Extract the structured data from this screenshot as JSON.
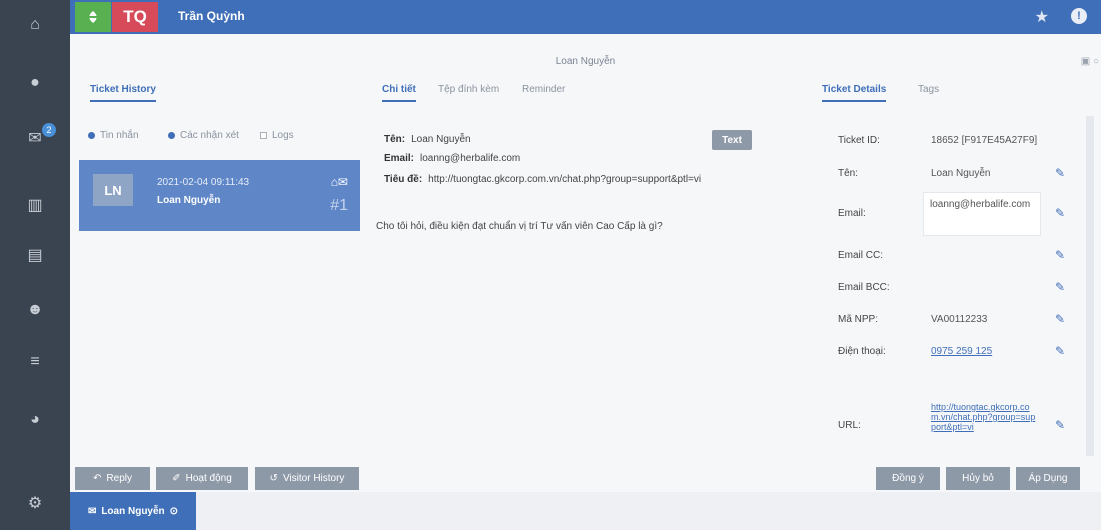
{
  "header": {
    "logo_icon": "herbalife-leaf-icon",
    "avatar_initials": "TQ",
    "user_name": "Trần Quỳnh",
    "star_glyph": "★",
    "info_glyph": "!"
  },
  "rail": {
    "items": [
      {
        "name": "home-icon",
        "glyph": "⌂"
      },
      {
        "name": "chat-icon",
        "glyph": "●"
      },
      {
        "name": "mail-icon",
        "glyph": "✉",
        "badge": "2"
      },
      {
        "name": "map-icon",
        "glyph": "▥"
      },
      {
        "name": "archive-icon",
        "glyph": "▤"
      },
      {
        "name": "users-icon",
        "glyph": "☻"
      },
      {
        "name": "database-icon",
        "glyph": "≡"
      },
      {
        "name": "pie-chart-icon",
        "glyph": "◕"
      },
      {
        "name": "settings-icon",
        "glyph": "⚙"
      }
    ]
  },
  "contact_title": "Loan Nguyễn",
  "window_controls": "▣ ○",
  "left_panel": {
    "tab_label": "Ticket History",
    "filters": [
      {
        "label": "Tin nhắn",
        "checked": true
      },
      {
        "label": "Các nhận xét",
        "checked": true
      },
      {
        "label": "Logs",
        "checked": false
      }
    ],
    "ticket": {
      "initials": "LN",
      "datetime": "2021-02-04 09:11:43",
      "name": "Loan Nguyễn",
      "icons": "⌂✉",
      "number": "#1"
    }
  },
  "center_panel": {
    "tabs": [
      "Chi tiết",
      "Tệp đính kèm",
      "Reminder"
    ],
    "name_label": "Tên:",
    "name_value": "Loan Nguyễn",
    "email_label": "Email:",
    "email_value": "loanng@herbalife.com",
    "subject_label": "Tiêu đề:",
    "subject_value": "http://tuongtac.gkcorp.com.vn/chat.php?group=support&ptl=vi",
    "text_button": "Text",
    "message": "Cho tôi hỏi, điều kiện đạt chuẩn vị trí Tư vấn viên Cao Cấp là gì?"
  },
  "right_panel": {
    "tabs": [
      "Ticket Details",
      "Tags"
    ],
    "fields": {
      "ticket_id_label": "Ticket ID:",
      "ticket_id_value": "18652 [F917E45A27F9]",
      "name_label": "Tên:",
      "name_value": "Loan Nguyễn",
      "email_label": "Email:",
      "email_value": "loanng@herbalife.com",
      "email_cc_label": "Email CC:",
      "email_bcc_label": "Email BCC:",
      "npp_label": "Mã NPP:",
      "npp_value": "VA00112233",
      "phone_label": "Điện thoại:",
      "phone_value": "0975 259 125",
      "url_label": "URL:",
      "url_value": "http://tuongtac.gkcorp.com.vn/chat.php?group=support&ptl=vi"
    },
    "pencil_glyph": "✎"
  },
  "actions": {
    "reply": "Reply",
    "activity": "Hoạt động",
    "visitor_history": "Visitor History",
    "agree": "Đồng ý",
    "cancel": "Hủy bỏ",
    "apply": "Áp Dụng"
  },
  "footer": {
    "tab_label": "Loan Nguyễn"
  }
}
